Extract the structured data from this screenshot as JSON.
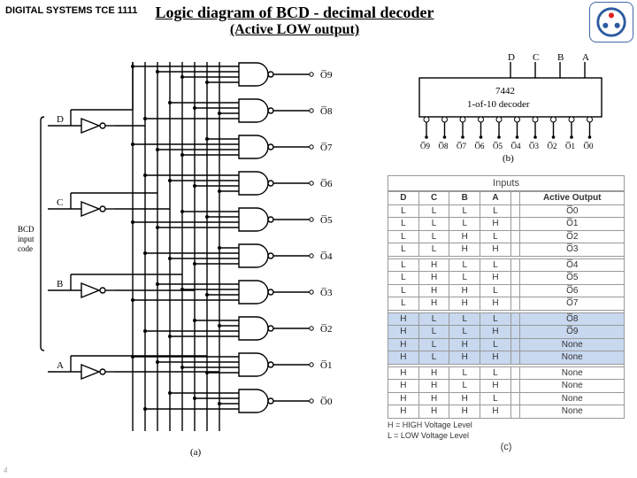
{
  "header": {
    "course": "DIGITAL SYSTEMS TCE 1111",
    "title": "Logic diagram of BCD - decimal decoder",
    "subtitle": "(Active LOW output)"
  },
  "circuit": {
    "input_code_label": "BCD\ninput\ncode",
    "inputs": [
      "D",
      "C",
      "B",
      "A"
    ],
    "outputs": [
      "O̅9",
      "O̅8",
      "O̅7",
      "O̅6",
      "O̅5",
      "O̅4",
      "O̅3",
      "O̅2",
      "O̅1",
      "O̅0"
    ],
    "caption": "(a)"
  },
  "chip": {
    "inputs_top": [
      "D",
      "C",
      "B",
      "A"
    ],
    "label_line1": "7442",
    "label_line2": "1-of-10 decoder",
    "outputs": [
      "O̅9",
      "O̅8",
      "O̅7",
      "O̅6",
      "O̅5",
      "O̅4",
      "O̅3",
      "O̅2",
      "O̅1",
      "O̅0"
    ],
    "caption": "(b)"
  },
  "table": {
    "title": "Inputs",
    "cols": [
      "D",
      "C",
      "B",
      "A",
      "Active Output"
    ],
    "rows": [
      {
        "d": "L",
        "c": "L",
        "b": "L",
        "a": "L",
        "o": "O̅0",
        "blue": false
      },
      {
        "d": "L",
        "c": "L",
        "b": "L",
        "a": "H",
        "o": "O̅1",
        "blue": false
      },
      {
        "d": "L",
        "c": "L",
        "b": "H",
        "a": "L",
        "o": "O̅2",
        "blue": false
      },
      {
        "d": "L",
        "c": "L",
        "b": "H",
        "a": "H",
        "o": "O̅3",
        "blue": false
      },
      {
        "d": "L",
        "c": "H",
        "b": "L",
        "a": "L",
        "o": "O̅4",
        "blue": false
      },
      {
        "d": "L",
        "c": "H",
        "b": "L",
        "a": "H",
        "o": "O̅5",
        "blue": false
      },
      {
        "d": "L",
        "c": "H",
        "b": "H",
        "a": "L",
        "o": "O̅6",
        "blue": false
      },
      {
        "d": "L",
        "c": "H",
        "b": "H",
        "a": "H",
        "o": "O̅7",
        "blue": false
      },
      {
        "d": "H",
        "c": "L",
        "b": "L",
        "a": "L",
        "o": "O̅8",
        "blue": true
      },
      {
        "d": "H",
        "c": "L",
        "b": "L",
        "a": "H",
        "o": "O̅9",
        "blue": true
      },
      {
        "d": "H",
        "c": "L",
        "b": "H",
        "a": "L",
        "o": "None",
        "blue": true
      },
      {
        "d": "H",
        "c": "L",
        "b": "H",
        "a": "H",
        "o": "None",
        "blue": true
      },
      {
        "d": "H",
        "c": "H",
        "b": "L",
        "a": "L",
        "o": "None",
        "blue": false
      },
      {
        "d": "H",
        "c": "H",
        "b": "L",
        "a": "H",
        "o": "None",
        "blue": false
      },
      {
        "d": "H",
        "c": "H",
        "b": "H",
        "a": "L",
        "o": "None",
        "blue": false
      },
      {
        "d": "H",
        "c": "H",
        "b": "H",
        "a": "H",
        "o": "None",
        "blue": false
      }
    ],
    "legend1": "H = HIGH Voltage Level",
    "legend2": "L = LOW Voltage Level",
    "caption": "(c)"
  },
  "footer": "4"
}
